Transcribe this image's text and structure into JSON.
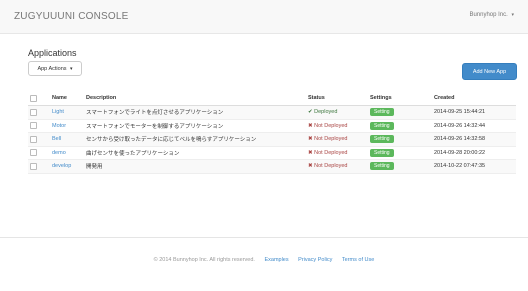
{
  "navbar": {
    "brand": "ZUGYUUUNI CONSOLE",
    "user": "Bunnyhop Inc."
  },
  "page": {
    "section_title": "Applications",
    "actions_label": "App Actions",
    "add_button": "Add New App"
  },
  "table": {
    "headers": [
      "Name",
      "Description",
      "Status",
      "Settings",
      "Created"
    ],
    "rows": [
      {
        "name": "Light",
        "description": "スマートフォンでライトを点灯させるアプリケーション",
        "status": "Deployed",
        "status_ok": true,
        "setting": "Setting",
        "created": "2014-09-25 15:44:21"
      },
      {
        "name": "Motor",
        "description": "スマートフォンでモーターを制御するアプリケーション",
        "status": "Not Deployed",
        "status_ok": false,
        "setting": "Setting",
        "created": "2014-09-26 14:32:44"
      },
      {
        "name": "Bell",
        "description": "センサから受け取ったデータに応じてベルを鳴らすアプリケーション",
        "status": "Not Deployed",
        "status_ok": false,
        "setting": "Setting",
        "created": "2014-09-26 14:32:58"
      },
      {
        "name": "demo",
        "description": "曲げセンサを使ったアプリケーション",
        "status": "Not Deployed",
        "status_ok": false,
        "setting": "Setting",
        "created": "2014-09-28 20:00:22"
      },
      {
        "name": "develop",
        "description": "開発用",
        "status": "Not Deployed",
        "status_ok": false,
        "setting": "Setting",
        "created": "2014-10-22 07:47:35"
      }
    ]
  },
  "footer": {
    "copyright": "© 2014 Bunnyhop Inc. All rights reserved.",
    "links": [
      "Examples",
      "Privacy Policy",
      "Terms of Use"
    ]
  },
  "colors": {
    "primary": "#428bca",
    "success": "#5cb85c",
    "danger": "#a94442"
  }
}
